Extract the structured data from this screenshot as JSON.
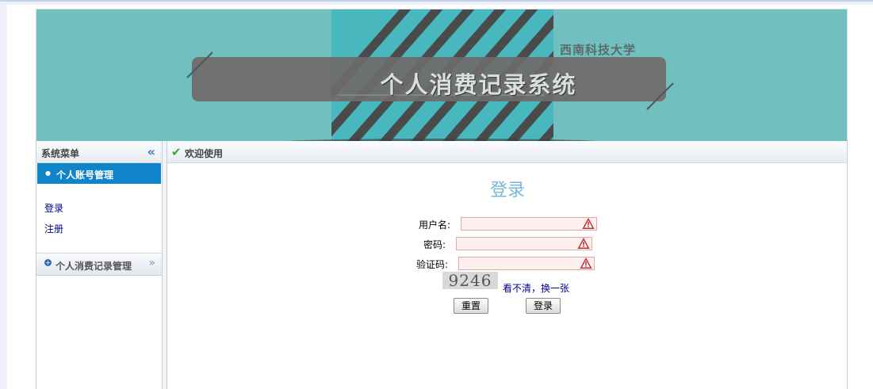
{
  "banner": {
    "title": "个人消费记录系统",
    "subtitle": "西南科技大学"
  },
  "sidebar": {
    "header": "系统菜单",
    "collapse_icon": "«",
    "active_section": "个人账号管理",
    "links": [
      "登录",
      "注册"
    ],
    "other_section": "个人消费记录管理"
  },
  "main": {
    "tab_title": "欢迎使用",
    "login": {
      "heading": "登录",
      "username_label": "用户名:",
      "password_label": "密码:",
      "captcha_label": "验证码:",
      "captcha_text": "9246",
      "refresh_link": "看不清，换一张",
      "reset_button": "重置",
      "submit_button": "登录"
    }
  },
  "colors": {
    "banner_bg": "#72bfc0",
    "active_menu": "#0f84c9",
    "heading": "#7ab8d8",
    "link": "#00008b"
  }
}
